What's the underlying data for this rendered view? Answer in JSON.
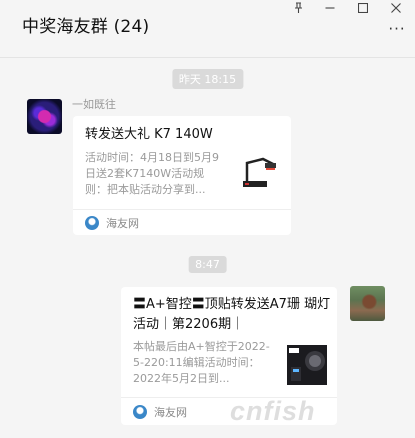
{
  "window": {
    "title": "中奖海友群 (24)",
    "more_glyph": "···",
    "controls": {
      "pin": "⊥",
      "minimize": "—",
      "maximize": "□",
      "close": "✕"
    }
  },
  "messages": [
    {
      "time": "昨天 18:15",
      "sender": "一如既往",
      "side": "left",
      "card": {
        "title": "转发送大礼 K7 140W",
        "desc": "活动时间：4月18日到5月9日送2套K7140W活动规则：把本贴活动分享到...",
        "source": "海友网",
        "thumb_icon": "led-lamp-icon"
      }
    },
    {
      "time": "8:47",
      "side": "right",
      "card": {
        "title": "〓A+智控〓顶贴转发送A7珊 瑚灯活动｜第2206期｜",
        "desc": "本帖最后由A+智控于2022-5-220:11编辑活动时间：2022年5月2日到...",
        "source": "海友网",
        "thumb_icon": "a7-coral-light-icon"
      }
    }
  ],
  "watermark": "cnfish",
  "colors": {
    "background": "#f5f5f5",
    "card": "#ffffff",
    "time_chip": "#dadada",
    "source_icon": "#3a87c8"
  }
}
